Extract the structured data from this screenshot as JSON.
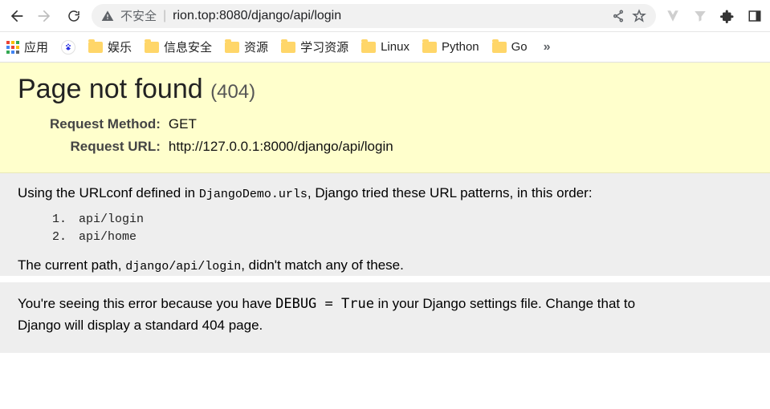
{
  "toolbar": {
    "security_text": "不安全",
    "url_display": "rion.top:8080/django/api/login"
  },
  "bookmarks": {
    "apps_label": "应用",
    "baidu_label": "",
    "items": [
      {
        "label": "娱乐"
      },
      {
        "label": "信息安全"
      },
      {
        "label": "资源"
      },
      {
        "label": "学习资源"
      },
      {
        "label": "Linux"
      },
      {
        "label": "Python"
      },
      {
        "label": "Go"
      }
    ],
    "more": "»"
  },
  "django": {
    "title": "Page not found",
    "status_code": "(404)",
    "req_method_label": "Request Method:",
    "req_method_value": "GET",
    "req_url_label": "Request URL:",
    "req_url_value": "http://127.0.0.1:8000/django/api/login",
    "info_prefix": "Using the URLconf defined in ",
    "urlconf_module": "DjangoDemo.urls",
    "info_suffix": ", Django tried these URL patterns, in this order:",
    "patterns": [
      "api/login",
      "api/home"
    ],
    "curpath_prefix": "The current path, ",
    "curpath_value": "django/api/login",
    "curpath_suffix": ", didn't match any of these.",
    "explain_prefix": "You're seeing this error because you have ",
    "explain_code": "DEBUG = True",
    "explain_suffix": " in your Django settings file. Change that to",
    "explain_line2": "Django will display a standard 404 page."
  }
}
